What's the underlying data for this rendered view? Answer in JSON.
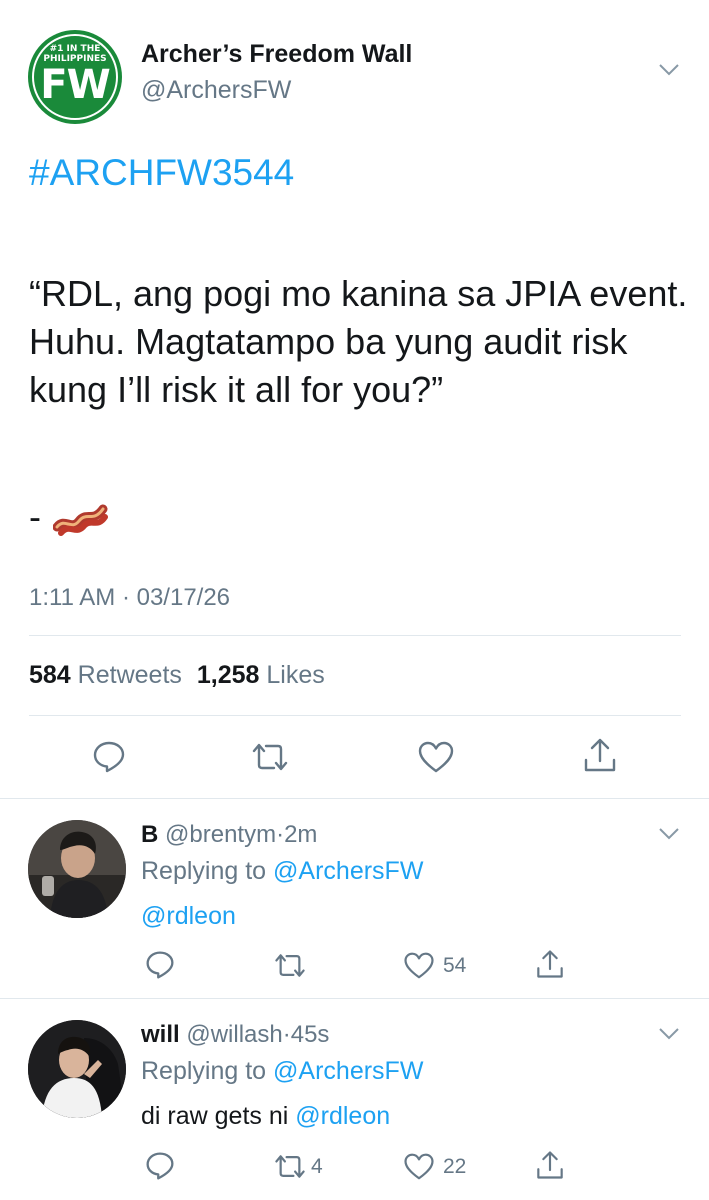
{
  "tweet": {
    "logo": {
      "top_text_1": "#1 IN THE",
      "top_text_2": "PHILIPPINES",
      "initials": "FW"
    },
    "display_name": "Archer’s Freedom Wall",
    "handle": "@ArchersFW",
    "hashtag": "#ARCHFW3544",
    "body": "“RDL, ang pogi mo kanina sa JPIA event. Huhu. Magtatampo ba yung audit risk kung I’ll risk it all for you?”",
    "signature_dash": "-",
    "signature_emoji": "bacon-emoji",
    "timestamp": "1:11 AM · 03/17/26",
    "retweets_count": "584",
    "retweets_label": "Retweets",
    "likes_count": "1,258",
    "likes_label": "Likes",
    "actions": [
      "reply-icon",
      "retweet-icon",
      "like-icon",
      "share-icon"
    ]
  },
  "replies": [
    {
      "name": "B",
      "handle": "@brentym",
      "sep": "·",
      "time": "2m",
      "replying_label": "Replying to",
      "replying_handle": "@ArchersFW",
      "text_prefix": "",
      "mention": "@rdleon",
      "retweet_count": "",
      "like_count": "54"
    },
    {
      "name": "will",
      "handle": "@willash",
      "sep": "·",
      "time": "45s",
      "replying_label": "Replying to",
      "replying_handle": "@ArchersFW",
      "text_prefix": "di raw gets ni",
      "mention": "@rdleon",
      "retweet_count": "4",
      "like_count": "22"
    }
  ],
  "colors": {
    "link": "#1da1f2",
    "secondary": "#657786",
    "divider": "#e1e8ed",
    "logo_green": "#1a8a3a"
  }
}
